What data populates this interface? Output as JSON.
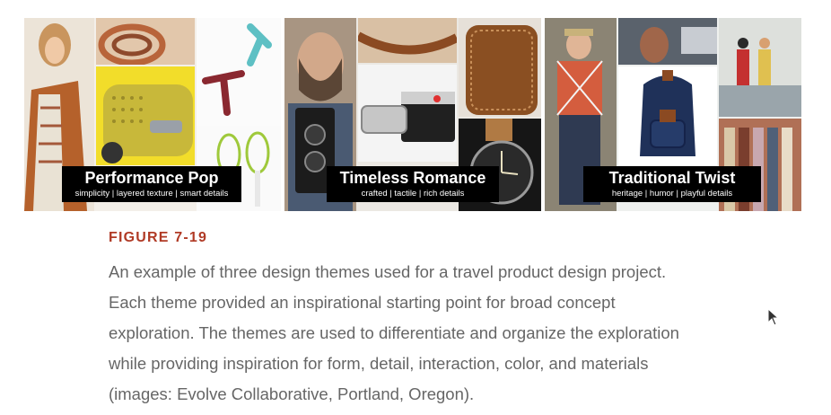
{
  "panels": [
    {
      "title": "Performance Pop",
      "subtitle": "simplicity | layered texture | smart details"
    },
    {
      "title": "Timeless Romance",
      "subtitle": "crafted | tactile | rich details"
    },
    {
      "title": "Traditional Twist",
      "subtitle": "heritage | humor | playful details"
    }
  ],
  "figure": {
    "label": "FIGURE 7-19",
    "lines": [
      "An example of three design themes used for a travel product design project.",
      "Each theme provided an inspirational starting point for broad concept",
      "exploration. The themes are used to differentiate and organize the exploration",
      "while providing inspiration for form, detail, interaction, color, and materials",
      "(images: Evolve Collaborative, Portland, Oregon)."
    ]
  }
}
